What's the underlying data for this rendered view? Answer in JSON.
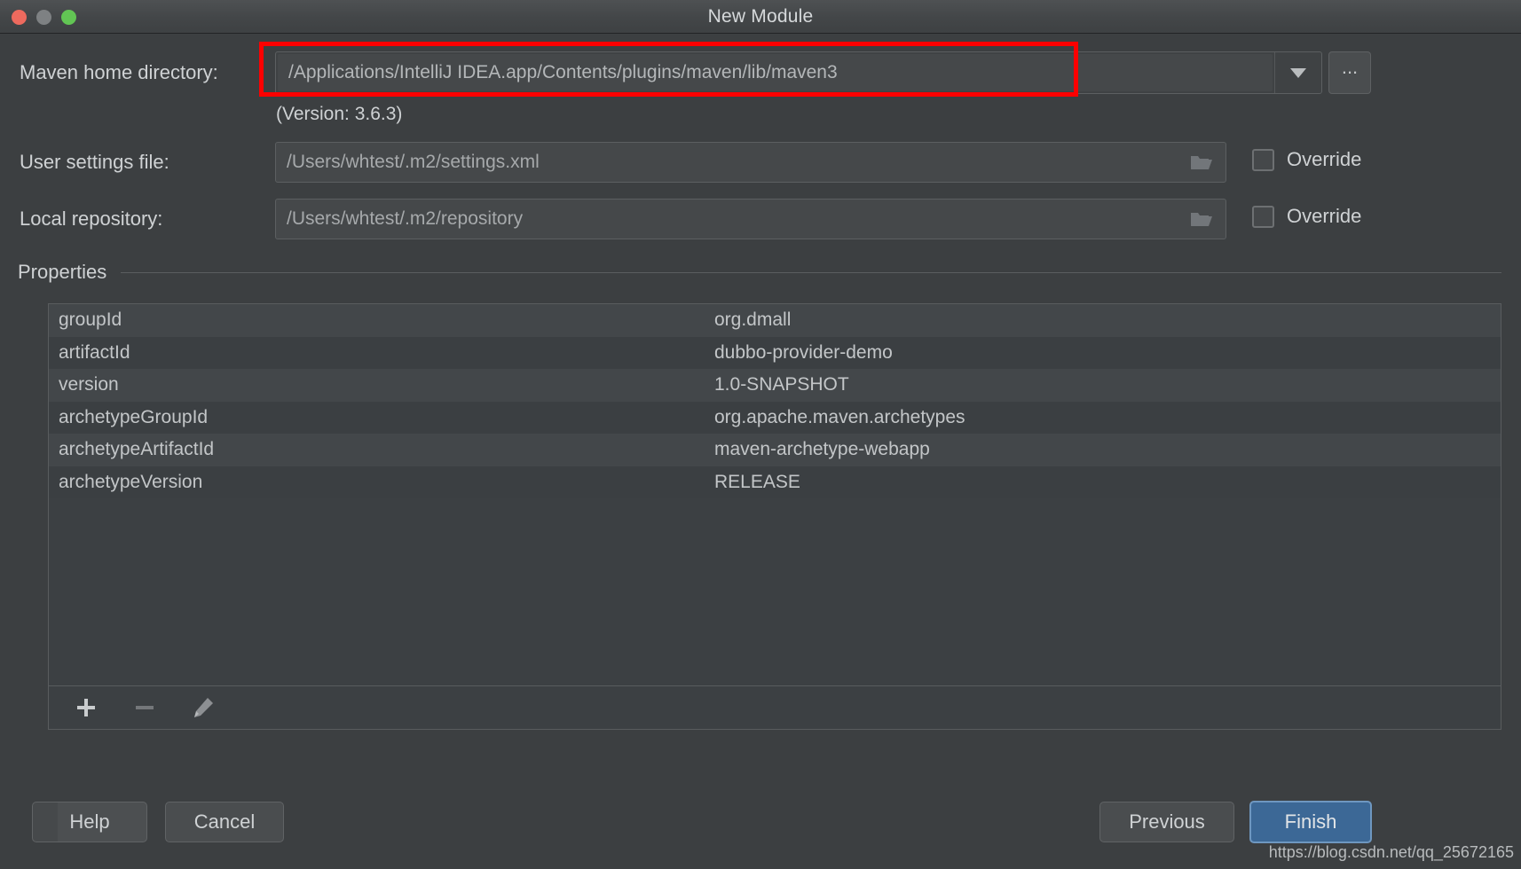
{
  "window": {
    "title": "New Module",
    "traffic_lights": [
      {
        "name": "close",
        "color": "#ed6a5e"
      },
      {
        "name": "minimize",
        "color": "#7e8183"
      },
      {
        "name": "maximize",
        "color": "#62c554"
      }
    ]
  },
  "form": {
    "maven_home": {
      "label": "Maven home directory:",
      "value": "/Applications/IntelliJ IDEA.app/Contents/plugins/maven/lib/maven3",
      "dropdown_icon": "chevron-down-icon",
      "browse_label": "...",
      "version_note": "(Version: 3.6.3)",
      "highlight_color": "#fe0000"
    },
    "user_settings": {
      "label": "User settings file:",
      "value": "/Users/whtest/.m2/settings.xml",
      "browse_icon": "folder-icon",
      "override_label": "Override",
      "override_checked": false
    },
    "local_repository": {
      "label": "Local repository:",
      "value": "/Users/whtest/.m2/repository",
      "browse_icon": "folder-icon",
      "override_label": "Override",
      "override_checked": false
    }
  },
  "properties": {
    "section_title": "Properties",
    "rows": [
      {
        "key": "groupId",
        "value": "org.dmall"
      },
      {
        "key": "artifactId",
        "value": "dubbo-provider-demo"
      },
      {
        "key": "version",
        "value": "1.0-SNAPSHOT"
      },
      {
        "key": "archetypeGroupId",
        "value": "org.apache.maven.archetypes"
      },
      {
        "key": "archetypeArtifactId",
        "value": "maven-archetype-webapp"
      },
      {
        "key": "archetypeVersion",
        "value": "RELEASE"
      }
    ],
    "toolbar": [
      {
        "name": "add-property-button",
        "icon": "plus-icon",
        "enabled": true
      },
      {
        "name": "remove-property-button",
        "icon": "minus-icon",
        "enabled": false
      },
      {
        "name": "edit-property-button",
        "icon": "pencil-icon",
        "enabled": true
      }
    ]
  },
  "footer": {
    "help_label": "Help",
    "cancel_label": "Cancel",
    "previous_label": "Previous",
    "finish_label": "Finish",
    "finish_color": "#3c6896"
  },
  "watermark": "https://blog.csdn.net/qq_25672165"
}
